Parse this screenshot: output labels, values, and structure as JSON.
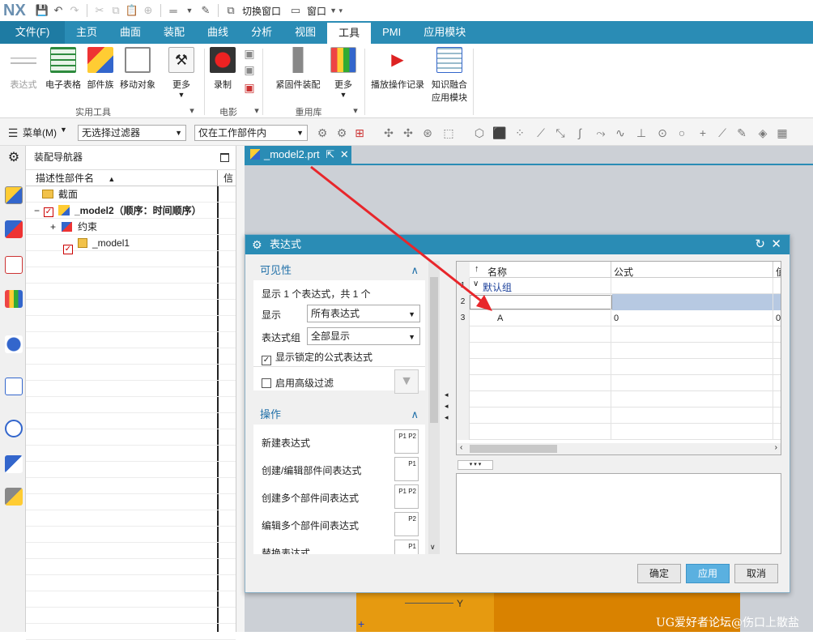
{
  "app": {
    "logo": "NX"
  },
  "quick_access": {
    "switch_window": "切换窗口",
    "window": "窗口"
  },
  "tabs": [
    {
      "label": "文件(F)"
    },
    {
      "label": "主页"
    },
    {
      "label": "曲面"
    },
    {
      "label": "装配"
    },
    {
      "label": "曲线"
    },
    {
      "label": "分析"
    },
    {
      "label": "视图"
    },
    {
      "label": "工具"
    },
    {
      "label": "PMI"
    },
    {
      "label": "应用模块"
    }
  ],
  "ribbon": {
    "buttons": [
      {
        "label": "表达式"
      },
      {
        "label": "电子表格"
      },
      {
        "label": "部件族"
      },
      {
        "label": "移动对象"
      },
      {
        "label": "更多"
      },
      {
        "label": "录制"
      },
      {
        "label": "紧固件装配"
      },
      {
        "label": "更多"
      },
      {
        "label": "播放操作记录"
      },
      {
        "label": "知识融合"
      },
      {
        "label": "应用模块"
      }
    ],
    "groups": [
      {
        "label": "实用工具"
      },
      {
        "label": "电影"
      },
      {
        "label": "重用库"
      }
    ]
  },
  "toolbar": {
    "menu": "菜单(M)",
    "filter": "无选择过滤器",
    "scope": "仅在工作部件内"
  },
  "navigator": {
    "title": "装配导航器",
    "column_name": "描述性部件名",
    "column_info": "信",
    "tree": [
      {
        "label": "截面"
      },
      {
        "label": "_model2（顺序：时间顺序）"
      },
      {
        "label": "约束"
      },
      {
        "label": "_model1"
      }
    ]
  },
  "document_tab": {
    "label": "_model2.prt"
  },
  "dialog": {
    "title": "表达式",
    "visibility": {
      "header": "可见性",
      "summary": "显示 1 个表达式，共 1 个",
      "show_label": "显示",
      "show_value": "所有表达式",
      "group_label": "表达式组",
      "group_value": "全部显示",
      "locked_label": "显示锁定的公式表达式",
      "advanced_label": "启用高级过滤"
    },
    "operations": {
      "header": "操作",
      "items": [
        {
          "label": "新建表达式",
          "icon": "P1 P2"
        },
        {
          "label": "创建/编辑部件间表达式",
          "icon": "P1"
        },
        {
          "label": "创建多个部件间表达式",
          "icon": "P1 P2"
        },
        {
          "label": "编辑多个部件间表达式",
          "icon": "P2"
        },
        {
          "label": "替换表达式",
          "icon": "P1"
        }
      ]
    },
    "table": {
      "col_name": "名称",
      "col_formula": "公式",
      "col_value": "值",
      "group_row": "默认组",
      "rows": [
        {
          "num": "1",
          "name": "",
          "formula": "",
          "value": ""
        },
        {
          "num": "2",
          "name": "",
          "formula": "",
          "value": ""
        },
        {
          "num": "3",
          "name": "A",
          "formula": "0",
          "value": "0"
        }
      ]
    },
    "buttons": {
      "ok": "确定",
      "apply": "应用",
      "cancel": "取消"
    }
  },
  "viewport": {
    "axis_y": "Y"
  },
  "watermark": "UG爱好者论坛@伤口上散盐"
}
